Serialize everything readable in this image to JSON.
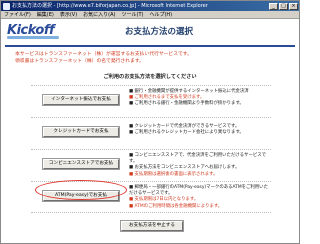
{
  "window": {
    "title": "お支払方法の選択 - [http://www.e7.biforjapan.co.jp] - Microsoft Internet Explorer",
    "controls": [
      "_",
      "□",
      "×"
    ]
  },
  "menubar": {
    "items": [
      "ファイル(F)",
      "編集(E)",
      "表示(V)",
      "お気に入り(A)",
      "ツール(T)",
      "ヘルプ(H)"
    ]
  },
  "logo": {
    "text": "Kickoff"
  },
  "page": {
    "title": "お支払方法の選択",
    "notice": "本サービスはトランスファーネット（株）が運営するお支払い代行サービスです。\n領収書はトランスファーネット（株）の名で発行されます。",
    "intro": "ご利用のお支払方法を選択してください"
  },
  "methods": [
    {
      "label": "インターネット振込でお支払",
      "lines": [
        "■ 銀行・金融機関が提供するインターネット振込に代金決済",
        "■ ご利用されるまで支払を受けます。",
        "■ ご利用される銀行・金融機関より手数料が掛かります。"
      ]
    },
    {
      "label": "クレジットカードでお支払",
      "lines": [
        "■ クレジットカードで代金決済ができるサービスです。",
        "■ ご利用されるクレジットカード会社により異なります。"
      ]
    },
    {
      "label": "コンビニエンスストアでお支払",
      "lines": [
        "■ コンビニエンスストアで、代金決済をご利用いただけるサービスです。",
        "■ お支払方法をコンビニエンスストアへお届けします。",
        "■ 支払期限は選択後の書面に表示されます。"
      ]
    },
    {
      "label": "ATM(Pay-easy)でお支払",
      "lines": [
        "■ 郵便局・一部銀行のATM(Pay-easy)マークのあるATMをご利用いただけるサービスです。",
        "■ 支払期限は7日以内となります。",
        "■ ATMのご利用時間は各金融機関によります。"
      ]
    }
  ],
  "cancel": {
    "label": "お支払方法を中止する"
  },
  "colors": {
    "titlebar": "#0a246a",
    "accent": "#2a4a9a",
    "notice": "#d23a1e",
    "highlight": "#e0352b"
  }
}
